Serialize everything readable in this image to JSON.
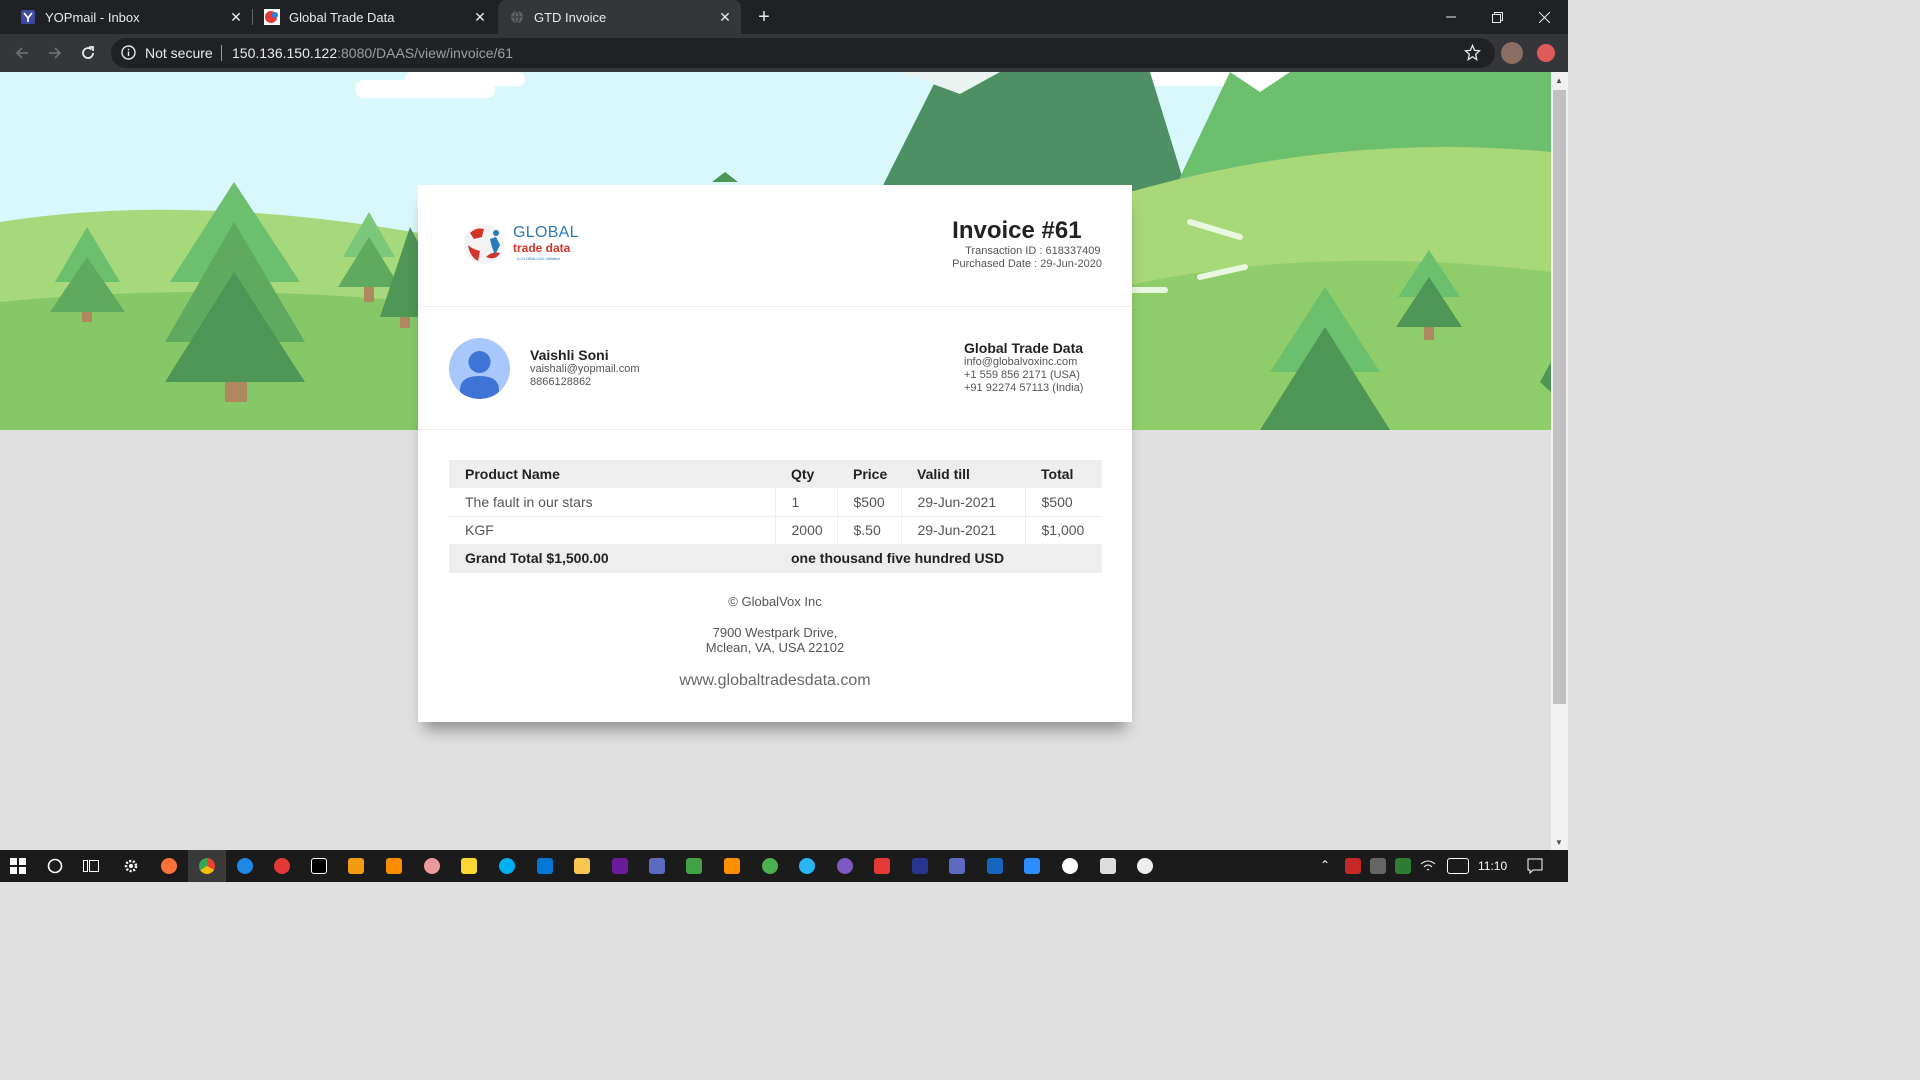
{
  "browser": {
    "tabs": [
      {
        "title": "YOPmail - Inbox",
        "icon": "yopmail-icon",
        "active": false
      },
      {
        "title": "Global Trade Data",
        "icon": "gtd-favicon",
        "active": false
      },
      {
        "title": "GTD Invoice",
        "icon": "globe-icon",
        "active": true
      }
    ],
    "security_label": "Not secure",
    "url_host": "150.136.150.122",
    "url_path": ":8080/DAAS/view/invoice/61"
  },
  "logo": {
    "line1": "GLOBAL",
    "line2": "trade data",
    "tagline": "A GLOBALVOX Initiative"
  },
  "invoice": {
    "title": "Invoice #61",
    "transaction_id": "Transaction ID : 618337409",
    "purchased_date": "Purchased Date : 29-Jun-2020"
  },
  "customer": {
    "name": "Vaishli Soni",
    "email": "vaishali@yopmail.com",
    "phone": "8866128862"
  },
  "seller": {
    "name": "Global Trade Data",
    "email": "info@globalvoxinc.com",
    "phone_us": "+1 559 856 2171 (USA)",
    "phone_in": "+91 92274 57113 (India)"
  },
  "table": {
    "headers": [
      "Product Name",
      "Qty",
      "Price",
      "Valid till",
      "Total"
    ],
    "rows": [
      [
        "The fault in our stars",
        "1",
        "$500",
        "29-Jun-2021",
        "$500"
      ],
      [
        "KGF",
        "2000",
        "$.50",
        "29-Jun-2021",
        "$1,000"
      ]
    ],
    "grand_total": "Grand Total $1,500.00",
    "amount_words": "one thousand five hundred USD"
  },
  "footer": {
    "copyright": "© GlobalVox Inc",
    "address_line1": "7900 Westpark Drive,",
    "address_line2": "Mclean, VA, USA 22102",
    "website": "www.globaltradesdata.com"
  },
  "taskbar": {
    "time": "11:10"
  },
  "colors": {
    "accent": "#2a7ab8",
    "avatar_bg": "#a8c7fa",
    "sky": "#d9f8fb",
    "grass": "#8bcf6c"
  }
}
